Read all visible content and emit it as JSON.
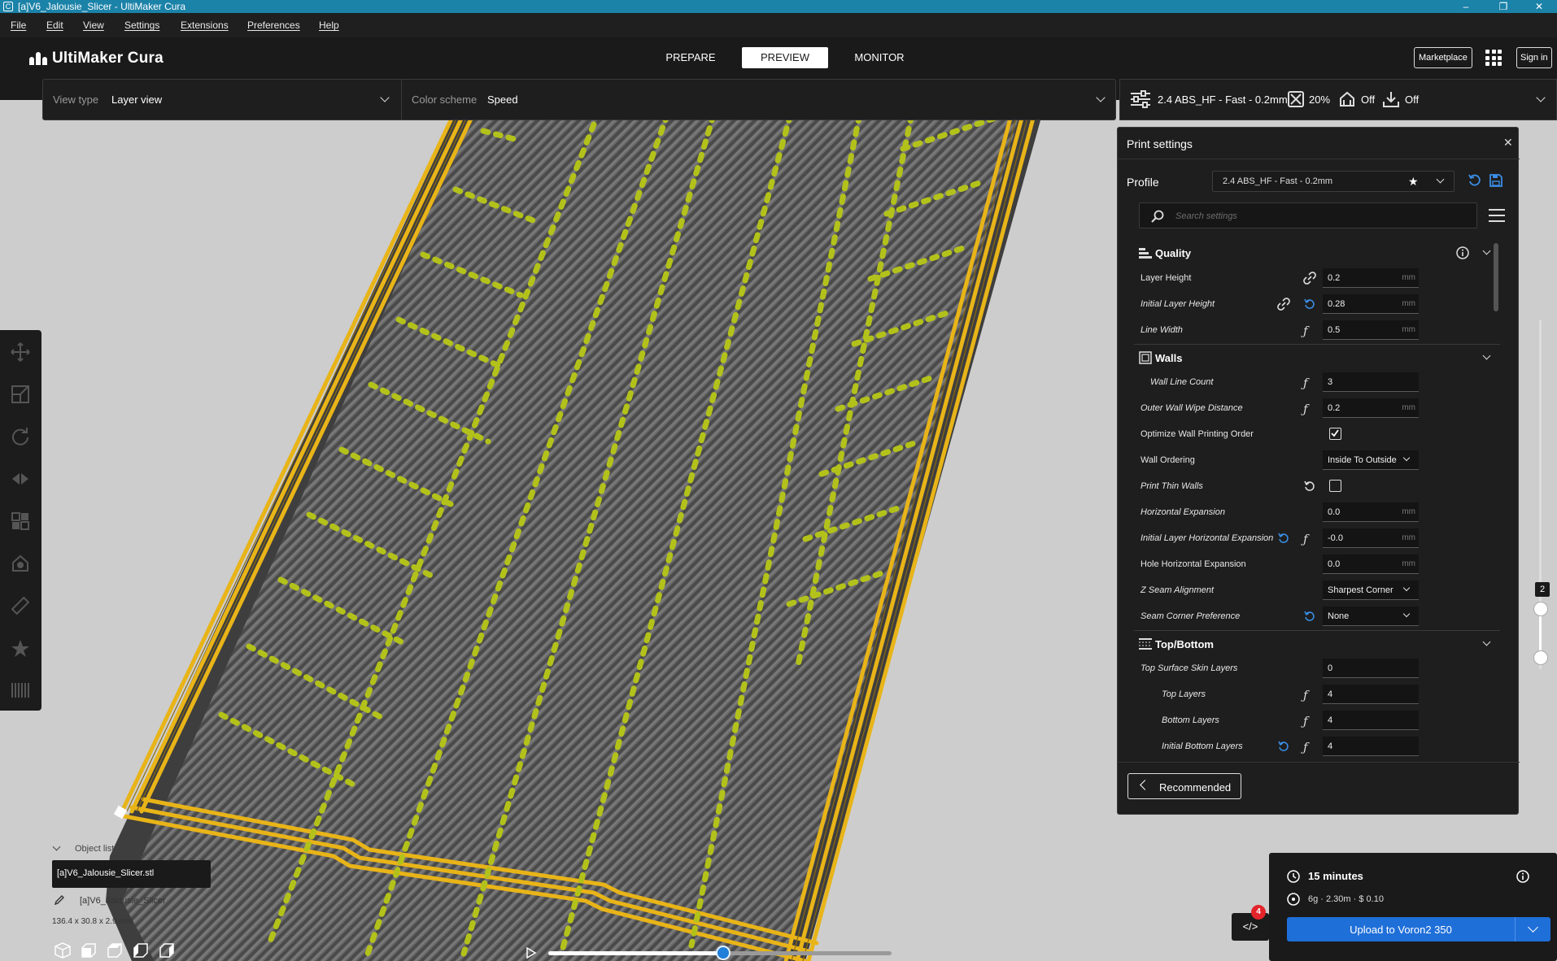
{
  "window": {
    "title": "[a]V6_Jalousie_Slicer - UltiMaker Cura",
    "controls": [
      "–",
      "❐",
      "✕"
    ]
  },
  "menu": [
    "File",
    "Edit",
    "View",
    "Settings",
    "Extensions",
    "Preferences",
    "Help"
  ],
  "header": {
    "logo_text": "UltiMaker Cura",
    "stages": [
      "PREPARE",
      "PREVIEW",
      "MONITOR"
    ],
    "active_stage": "PREVIEW",
    "marketplace_label": "Marketplace",
    "signin_label": "Sign in"
  },
  "viewbar": {
    "view_type_label": "View type",
    "view_type_value": "Layer view",
    "color_scheme_label": "Color scheme",
    "color_scheme_value": "Speed"
  },
  "setbar": {
    "profile": "2.4 ABS_HF - Fast - 0.2mm",
    "infill": "20%",
    "support": "Off",
    "adhesion": "Off"
  },
  "panel": {
    "title": "Print settings",
    "profile_label": "Profile",
    "profile_value": "2.4 ABS_HF - Fast - 0.2mm",
    "search_placeholder": "Search settings",
    "recommended_label": "Recommended",
    "categories": {
      "quality": "Quality",
      "walls": "Walls",
      "topbottom": "Top/Bottom"
    },
    "rows": {
      "layer_height": {
        "label": "Layer Height",
        "value": "0.2",
        "unit": "mm"
      },
      "initial_layer_height": {
        "label": "Initial Layer Height",
        "value": "0.28",
        "unit": "mm"
      },
      "line_width": {
        "label": "Line Width",
        "value": "0.5",
        "unit": "mm"
      },
      "wall_line_count": {
        "label": "Wall Line Count",
        "value": "3"
      },
      "outer_wall_wipe": {
        "label": "Outer Wall Wipe Distance",
        "value": "0.2",
        "unit": "mm"
      },
      "optimize_wall": {
        "label": "Optimize Wall Printing Order",
        "checked": true
      },
      "wall_ordering": {
        "label": "Wall Ordering",
        "value": "Inside To Outside"
      },
      "print_thin_walls": {
        "label": "Print Thin Walls",
        "checked": false
      },
      "horizontal_expansion": {
        "label": "Horizontal Expansion",
        "value": "0.0",
        "unit": "mm"
      },
      "initial_layer_hexp": {
        "label": "Initial Layer Horizontal Expansion",
        "value": "-0.0",
        "unit": "mm"
      },
      "hole_hexp": {
        "label": "Hole Horizontal Expansion",
        "value": "0.0",
        "unit": "mm"
      },
      "z_seam": {
        "label": "Z Seam Alignment",
        "value": "Sharpest Corner"
      },
      "seam_corner": {
        "label": "Seam Corner Preference",
        "value": "None"
      },
      "top_surface_skin": {
        "label": "Top Surface Skin Layers",
        "value": "0"
      },
      "top_layers": {
        "label": "Top Layers",
        "value": "4"
      },
      "bottom_layers": {
        "label": "Bottom Layers",
        "value": "4"
      },
      "initial_bottom_layers": {
        "label": "Initial Bottom Layers",
        "value": "4"
      }
    }
  },
  "object_list": {
    "header": "Object list",
    "file": "[a]V6_Jalousie_Slicer.stl",
    "name": "[a]V6_Jalousie_Slicer",
    "dimensions": "136.4 x 30.8 x 2.9 mm"
  },
  "layer_slider": {
    "current_layer": "2"
  },
  "playback": {
    "progress": 0.51
  },
  "extension_badge": {
    "count": "4"
  },
  "print_info": {
    "time": "15 minutes",
    "material": "6g · 2.30m · $ 0.10",
    "upload_label": "Upload to Voron2 350"
  },
  "colors": {
    "accent": "#1f6fd9",
    "wall_yellow": "#e8b418",
    "infill_green": "#b3c21a",
    "skin_grey": "#5a5a5a",
    "titlebar": "#1b82a8"
  }
}
